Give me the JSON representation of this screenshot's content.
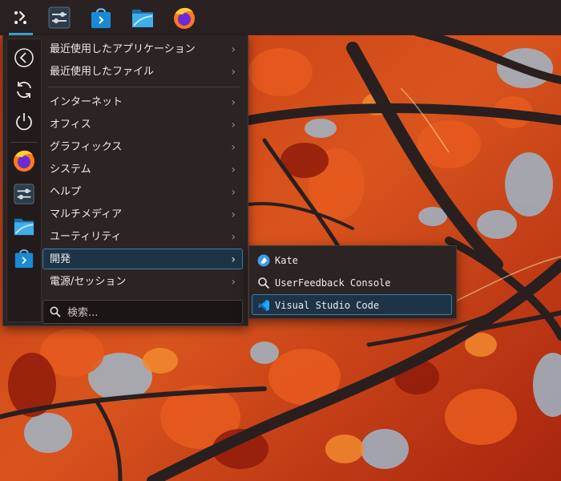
{
  "panel": {
    "launcher_icon": "kde-launcher-icon",
    "pinned": [
      {
        "name": "system-settings-icon"
      },
      {
        "name": "discover-store-icon"
      },
      {
        "name": "dolphin-files-icon"
      },
      {
        "name": "firefox-icon"
      }
    ]
  },
  "menu": {
    "sidebar": {
      "back_icon": "back-icon",
      "restart_icon": "restart-icon",
      "power_icon": "power-icon",
      "favorites": [
        "firefox-icon",
        "system-settings-icon",
        "dolphin-files-icon",
        "discover-store-icon"
      ]
    },
    "categories": [
      {
        "label": "最近使用したアプリケーション"
      },
      {
        "label": "最近使用したファイル"
      },
      {
        "label": "インターネット"
      },
      {
        "label": "オフィス"
      },
      {
        "label": "グラフィックス"
      },
      {
        "label": "システム"
      },
      {
        "label": "ヘルプ"
      },
      {
        "label": "マルチメディア"
      },
      {
        "label": "ユーティリティ"
      },
      {
        "label": "開発"
      },
      {
        "label": "電源/セッション"
      }
    ],
    "active_category": "開発",
    "chevron": "›",
    "search": {
      "placeholder": "検索..."
    }
  },
  "submenu": {
    "items": [
      {
        "label": "Kate",
        "icon": "kate-icon"
      },
      {
        "label": "UserFeedback Console",
        "icon": "magnifier-icon"
      },
      {
        "label": "Visual Studio Code",
        "icon": "vscode-icon"
      }
    ],
    "active_item": "Visual Studio Code"
  },
  "colors": {
    "accent": "#3daee9",
    "panel_bg": "#2a2222",
    "menu_bg": "#2c2323",
    "highlight_bg": "#1d3447",
    "highlight_border": "#3c7fb1"
  }
}
